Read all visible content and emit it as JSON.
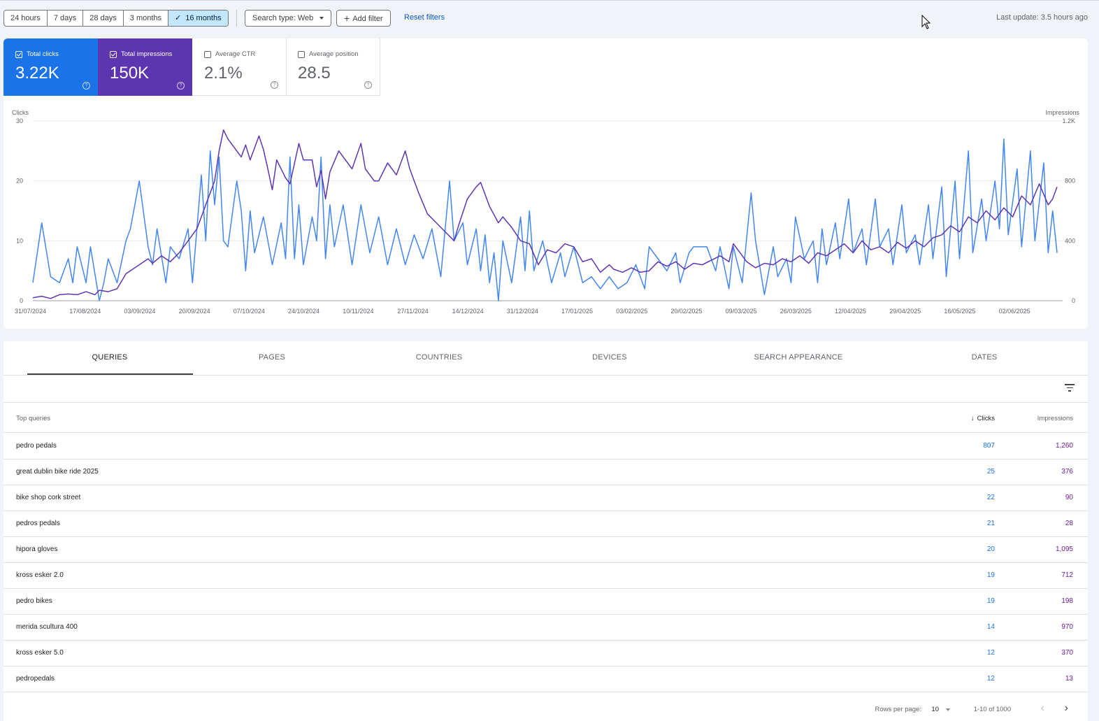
{
  "toolbar": {
    "ranges": [
      "24 hours",
      "7 days",
      "28 days",
      "3 months",
      "16 months"
    ],
    "active_range": "16 months",
    "search_type": "Search type: Web",
    "add_filter": "Add filter",
    "reset_filters": "Reset filters",
    "last_update": "Last update: 3.5 hours ago"
  },
  "metrics": {
    "clicks": {
      "label": "Total clicks",
      "value": "3.22K",
      "checked": true,
      "color": "#1a73e8"
    },
    "impressions": {
      "label": "Total impressions",
      "value": "150K",
      "checked": true,
      "color": "#5e35b1"
    },
    "ctr": {
      "label": "Average CTR",
      "value": "2.1%",
      "checked": false
    },
    "position": {
      "label": "Average position",
      "value": "28.5",
      "checked": false
    }
  },
  "chart_data": {
    "type": "line",
    "ylabel_left": "Clicks",
    "ylabel_right": "Impressions",
    "ylim_left": [
      0,
      30
    ],
    "ylim_right": [
      0,
      1200
    ],
    "yticks_left": [
      "0",
      "10",
      "20",
      "30"
    ],
    "yticks_right": [
      "0",
      "400",
      "800",
      "1.2K"
    ],
    "x_tick_labels": [
      "31/07/2024",
      "17/08/2024",
      "03/09/2024",
      "20/09/2024",
      "07/10/2024",
      "24/10/2024",
      "10/11/2024",
      "27/11/2024",
      "14/12/2024",
      "31/12/2024",
      "17/01/2025",
      "03/02/2025",
      "20/02/2025",
      "09/03/2025",
      "26/03/2025",
      "12/04/2025",
      "29/04/2025",
      "16/05/2025",
      "02/06/2025"
    ],
    "x_start": "31/07/2024",
    "x_end": "09/06/2025",
    "grid": true,
    "series": [
      {
        "name": "Clicks",
        "axis": "left",
        "color": "#4285f4",
        "anchors": [
          [
            0,
            3
          ],
          [
            2,
            13
          ],
          [
            4,
            4
          ],
          [
            6,
            3
          ],
          [
            8,
            7
          ],
          [
            9,
            3
          ],
          [
            10,
            9
          ],
          [
            12,
            3
          ],
          [
            13,
            9
          ],
          [
            15,
            0
          ],
          [
            16,
            3
          ],
          [
            17,
            7
          ],
          [
            19,
            3
          ],
          [
            21,
            10
          ],
          [
            22,
            12
          ],
          [
            24,
            20
          ],
          [
            26,
            9
          ],
          [
            27,
            6
          ],
          [
            28,
            12
          ],
          [
            30,
            3
          ],
          [
            31,
            9
          ],
          [
            33,
            7
          ],
          [
            35,
            12
          ],
          [
            36,
            3
          ],
          [
            38,
            21
          ],
          [
            39,
            10
          ],
          [
            40,
            25
          ],
          [
            41,
            16
          ],
          [
            42,
            24
          ],
          [
            43,
            10
          ],
          [
            44,
            9
          ],
          [
            46,
            20
          ],
          [
            47,
            15
          ],
          [
            48,
            5
          ],
          [
            49,
            15
          ],
          [
            50,
            8
          ],
          [
            52,
            14
          ],
          [
            54,
            6
          ],
          [
            56,
            13
          ],
          [
            57,
            7
          ],
          [
            58,
            24
          ],
          [
            59,
            7
          ],
          [
            60,
            16
          ],
          [
            61,
            6
          ],
          [
            63,
            14
          ],
          [
            64,
            10
          ],
          [
            65,
            24
          ],
          [
            66,
            7
          ],
          [
            67,
            16
          ],
          [
            68,
            9
          ],
          [
            70,
            16
          ],
          [
            72,
            6
          ],
          [
            74,
            16
          ],
          [
            76,
            8
          ],
          [
            78,
            14
          ],
          [
            80,
            6
          ],
          [
            82,
            12
          ],
          [
            84,
            6
          ],
          [
            86,
            11
          ],
          [
            88,
            7
          ],
          [
            90,
            12
          ],
          [
            92,
            4
          ],
          [
            94,
            20
          ],
          [
            95,
            10
          ],
          [
            97,
            13
          ],
          [
            98,
            6
          ],
          [
            100,
            12
          ],
          [
            101,
            5
          ],
          [
            102,
            11
          ],
          [
            103,
            3
          ],
          [
            104,
            8
          ],
          [
            105,
            0
          ],
          [
            106,
            10
          ],
          [
            108,
            3
          ],
          [
            110,
            14
          ],
          [
            111,
            5
          ],
          [
            112,
            15
          ],
          [
            113,
            5
          ],
          [
            115,
            10
          ],
          [
            117,
            3
          ],
          [
            119,
            8
          ],
          [
            120,
            4
          ],
          [
            122,
            9
          ],
          [
            124,
            3
          ],
          [
            126,
            4
          ],
          [
            128,
            2
          ],
          [
            130,
            4
          ],
          [
            132,
            2
          ],
          [
            134,
            3
          ],
          [
            136,
            6
          ],
          [
            138,
            2
          ],
          [
            139,
            9
          ],
          [
            141,
            7
          ],
          [
            143,
            5
          ],
          [
            145,
            8
          ],
          [
            146,
            3
          ],
          [
            148,
            8
          ],
          [
            149,
            9
          ],
          [
            152,
            9
          ],
          [
            154,
            5
          ],
          [
            155,
            9
          ],
          [
            157,
            2
          ],
          [
            158,
            9
          ],
          [
            160,
            3
          ],
          [
            162,
            18
          ],
          [
            163,
            10
          ],
          [
            165,
            1
          ],
          [
            167,
            9
          ],
          [
            168,
            4
          ],
          [
            170,
            7
          ],
          [
            171,
            3
          ],
          [
            172,
            14
          ],
          [
            174,
            7
          ],
          [
            176,
            10
          ],
          [
            177,
            3
          ],
          [
            178,
            12
          ],
          [
            179,
            6
          ],
          [
            181,
            13
          ],
          [
            182,
            7
          ],
          [
            184,
            17
          ],
          [
            185,
            8
          ],
          [
            187,
            12
          ],
          [
            188,
            6
          ],
          [
            190,
            17
          ],
          [
            191,
            9
          ],
          [
            193,
            12
          ],
          [
            194,
            6
          ],
          [
            196,
            16
          ],
          [
            197,
            8
          ],
          [
            199,
            11
          ],
          [
            200,
            6
          ],
          [
            202,
            16
          ],
          [
            203,
            7
          ],
          [
            205,
            19
          ],
          [
            206,
            4
          ],
          [
            208,
            20
          ],
          [
            209,
            7
          ],
          [
            211,
            25
          ],
          [
            212,
            8
          ],
          [
            214,
            17
          ],
          [
            215,
            10
          ],
          [
            217,
            20
          ],
          [
            218,
            12
          ],
          [
            219,
            27
          ],
          [
            220,
            11
          ],
          [
            222,
            22
          ],
          [
            223,
            9
          ],
          [
            225,
            25
          ],
          [
            226,
            10
          ],
          [
            228,
            23
          ],
          [
            229,
            8
          ],
          [
            230,
            15
          ],
          [
            231,
            8
          ]
        ]
      },
      {
        "name": "Impressions",
        "axis": "right",
        "color": "#5e35b1",
        "anchors": [
          [
            0,
            20
          ],
          [
            2,
            30
          ],
          [
            4,
            15
          ],
          [
            6,
            40
          ],
          [
            8,
            45
          ],
          [
            10,
            40
          ],
          [
            12,
            60
          ],
          [
            14,
            40
          ],
          [
            15,
            70
          ],
          [
            17,
            60
          ],
          [
            19,
            80
          ],
          [
            21,
            180
          ],
          [
            22,
            200
          ],
          [
            24,
            240
          ],
          [
            26,
            280
          ],
          [
            27,
            250
          ],
          [
            29,
            300
          ],
          [
            31,
            260
          ],
          [
            33,
            320
          ],
          [
            35,
            400
          ],
          [
            37,
            480
          ],
          [
            39,
            640
          ],
          [
            40,
            720
          ],
          [
            41,
            800
          ],
          [
            42,
            1000
          ],
          [
            43,
            1140
          ],
          [
            44,
            1080
          ],
          [
            46,
            1000
          ],
          [
            47,
            960
          ],
          [
            48,
            1040
          ],
          [
            49,
            940
          ],
          [
            51,
            1100
          ],
          [
            52,
            1010
          ],
          [
            53,
            880
          ],
          [
            54,
            740
          ],
          [
            55,
            940
          ],
          [
            57,
            820
          ],
          [
            58,
            780
          ],
          [
            60,
            1050
          ],
          [
            61,
            940
          ],
          [
            63,
            940
          ],
          [
            64,
            760
          ],
          [
            65,
            870
          ],
          [
            66,
            680
          ],
          [
            67,
            860
          ],
          [
            69,
            1000
          ],
          [
            71,
            920
          ],
          [
            72,
            880
          ],
          [
            74,
            1050
          ],
          [
            75,
            880
          ],
          [
            77,
            800
          ],
          [
            78,
            800
          ],
          [
            80,
            920
          ],
          [
            82,
            840
          ],
          [
            84,
            1000
          ],
          [
            85,
            880
          ],
          [
            87,
            720
          ],
          [
            89,
            580
          ],
          [
            91,
            520
          ],
          [
            93,
            460
          ],
          [
            95,
            400
          ],
          [
            96,
            500
          ],
          [
            98,
            680
          ],
          [
            100,
            760
          ],
          [
            101,
            790
          ],
          [
            103,
            630
          ],
          [
            105,
            520
          ],
          [
            106,
            560
          ],
          [
            108,
            490
          ],
          [
            110,
            400
          ],
          [
            112,
            380
          ],
          [
            114,
            240
          ],
          [
            116,
            340
          ],
          [
            118,
            320
          ],
          [
            120,
            380
          ],
          [
            122,
            360
          ],
          [
            124,
            260
          ],
          [
            126,
            280
          ],
          [
            128,
            190
          ],
          [
            130,
            240
          ],
          [
            131,
            210
          ],
          [
            133,
            190
          ],
          [
            135,
            220
          ],
          [
            137,
            190
          ],
          [
            139,
            200
          ],
          [
            141,
            260
          ],
          [
            143,
            230
          ],
          [
            145,
            260
          ],
          [
            147,
            210
          ],
          [
            149,
            250
          ],
          [
            151,
            240
          ],
          [
            153,
            270
          ],
          [
            155,
            300
          ],
          [
            157,
            260
          ],
          [
            158,
            380
          ],
          [
            159,
            340
          ],
          [
            161,
            260
          ],
          [
            163,
            220
          ],
          [
            165,
            250
          ],
          [
            167,
            240
          ],
          [
            169,
            280
          ],
          [
            171,
            260
          ],
          [
            173,
            300
          ],
          [
            175,
            250
          ],
          [
            177,
            320
          ],
          [
            179,
            300
          ],
          [
            181,
            340
          ],
          [
            183,
            380
          ],
          [
            185,
            320
          ],
          [
            187,
            400
          ],
          [
            189,
            340
          ],
          [
            191,
            360
          ],
          [
            193,
            320
          ],
          [
            195,
            390
          ],
          [
            197,
            350
          ],
          [
            199,
            400
          ],
          [
            201,
            360
          ],
          [
            203,
            420
          ],
          [
            205,
            440
          ],
          [
            207,
            500
          ],
          [
            209,
            460
          ],
          [
            211,
            560
          ],
          [
            213,
            520
          ],
          [
            215,
            600
          ],
          [
            217,
            540
          ],
          [
            219,
            620
          ],
          [
            221,
            560
          ],
          [
            223,
            700
          ],
          [
            225,
            640
          ],
          [
            227,
            780
          ],
          [
            229,
            640
          ],
          [
            230,
            680
          ],
          [
            231,
            760
          ]
        ]
      }
    ]
  },
  "tabs": [
    "QUERIES",
    "PAGES",
    "COUNTRIES",
    "DEVICES",
    "SEARCH APPEARANCE",
    "DATES"
  ],
  "active_tab": "QUERIES",
  "table": {
    "headers": {
      "query": "Top queries",
      "clicks": "Clicks",
      "impressions": "Impressions"
    },
    "rows": [
      {
        "query": "pedro pedals",
        "clicks": "807",
        "impressions": "1,260"
      },
      {
        "query": "great dublin bike ride 2025",
        "clicks": "25",
        "impressions": "376"
      },
      {
        "query": "bike shop cork street",
        "clicks": "22",
        "impressions": "90"
      },
      {
        "query": "pedros pedals",
        "clicks": "21",
        "impressions": "28"
      },
      {
        "query": "hipora gloves",
        "clicks": "20",
        "impressions": "1,095"
      },
      {
        "query": "kross esker 2.0",
        "clicks": "19",
        "impressions": "712"
      },
      {
        "query": "pedro bikes",
        "clicks": "19",
        "impressions": "198"
      },
      {
        "query": "merida scultura 400",
        "clicks": "14",
        "impressions": "970"
      },
      {
        "query": "kross esker 5.0",
        "clicks": "12",
        "impressions": "370"
      },
      {
        "query": "pedropedals",
        "clicks": "12",
        "impressions": "13"
      }
    ]
  },
  "pagination": {
    "rows_per_page_label": "Rows per page:",
    "rows_per_page": "10",
    "range": "1-10 of 1000"
  },
  "icons": {
    "help": "help-circle-icon",
    "filter": "filter-list-icon",
    "sort": "arrow-down-icon",
    "prev": "chevron-left-icon",
    "next": "chevron-right-icon"
  }
}
